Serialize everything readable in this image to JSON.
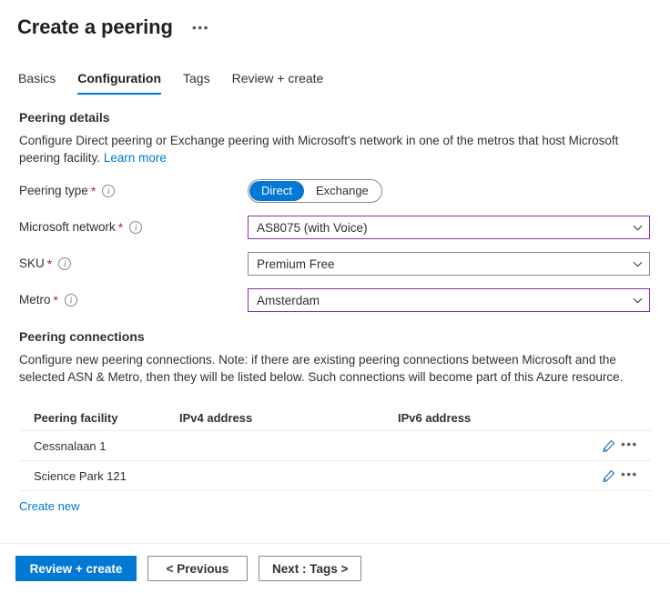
{
  "header": {
    "title": "Create a peering",
    "more_menu": "•••"
  },
  "tabs": [
    {
      "label": "Basics",
      "selected": false
    },
    {
      "label": "Configuration",
      "selected": true
    },
    {
      "label": "Tags",
      "selected": false
    },
    {
      "label": "Review + create",
      "selected": false
    }
  ],
  "peering_details": {
    "title": "Peering details",
    "description": "Configure Direct peering or Exchange peering with Microsoft's network in one of the metros that host Microsoft peering facility.",
    "learn_more": "Learn more",
    "peering_type": {
      "label": "Peering type",
      "required": "*",
      "info": "i",
      "options": [
        "Direct",
        "Exchange"
      ],
      "selected": "Direct"
    },
    "microsoft_network": {
      "label": "Microsoft network",
      "required": "*",
      "info": "i",
      "value": "AS8075 (with Voice)",
      "accent": true
    },
    "sku": {
      "label": "SKU",
      "required": "*",
      "info": "i",
      "value": "Premium Free",
      "accent": false
    },
    "metro": {
      "label": "Metro",
      "required": "*",
      "info": "i",
      "value": "Amsterdam",
      "accent": true
    }
  },
  "peering_connections": {
    "title": "Peering connections",
    "description": "Configure new peering connections. Note: if there are existing peering connections between Microsoft and the selected ASN & Metro, then they will be listed below. Such connections will become part of this Azure resource.",
    "columns": {
      "facility": "Peering facility",
      "ipv4": "IPv4 address",
      "ipv6": "IPv6 address"
    },
    "rows": [
      {
        "facility": "Cessnalaan 1",
        "ipv4": "",
        "ipv6": ""
      },
      {
        "facility": "Science Park 121",
        "ipv4": "",
        "ipv6": ""
      }
    ],
    "row_action_edit": "edit-icon",
    "row_action_more": "•••",
    "create_new": "Create new"
  },
  "footer": {
    "review_create": "Review + create",
    "previous": "< Previous",
    "next": "Next : Tags >"
  },
  "colors": {
    "accent_blue": "#0078d4",
    "accent_purple": "#8f2eb0",
    "required_red": "#a4262c",
    "link_blue": "#0078d4"
  }
}
